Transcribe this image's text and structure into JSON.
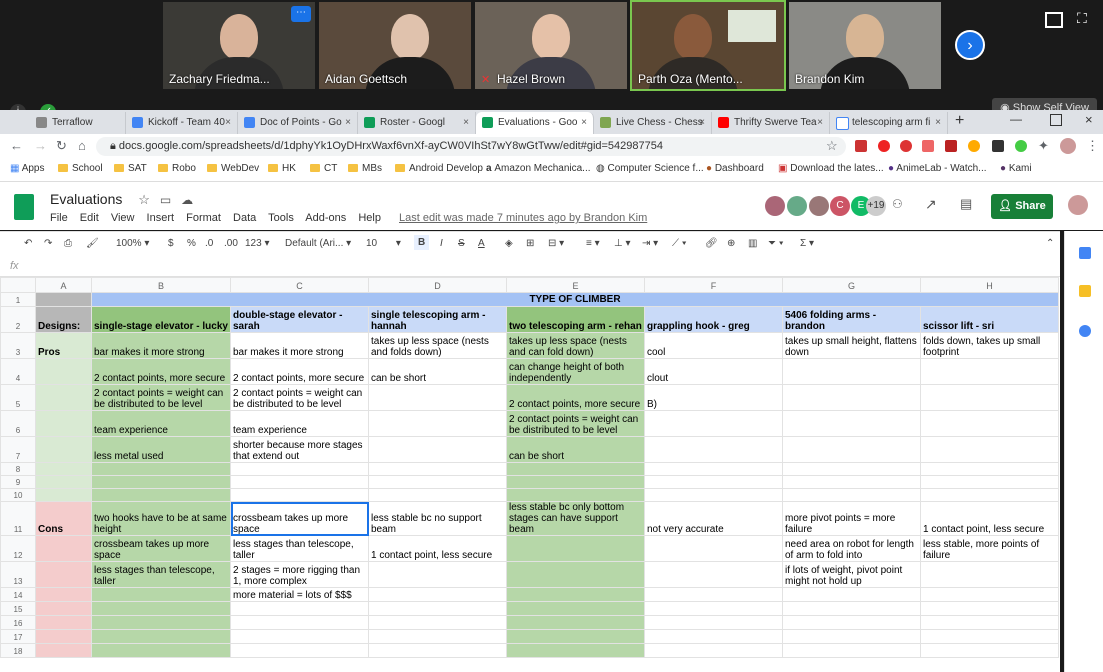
{
  "zoom": {
    "participants": [
      "Zachary Friedma...",
      "Aidan Goettsch",
      "Hazel Brown",
      "Parth Oza (Mento...",
      "Brandon Kim"
    ],
    "self_view_label": "Show Self View"
  },
  "browser": {
    "tabs": [
      {
        "title": "Terraflow"
      },
      {
        "title": "Kickoff - Team 40"
      },
      {
        "title": "Doc of Points - Go"
      },
      {
        "title": "Roster - Googl"
      },
      {
        "title": "Evaluations - Goo"
      },
      {
        "title": "Live Chess - Chess"
      },
      {
        "title": "Thrifty Swerve Tea"
      },
      {
        "title": "telescoping arm fi"
      }
    ],
    "url": "docs.google.com/spreadsheets/d/1dphyYk1OyDHrxWaxf6vnXf-ayCW0VIhSt7wY8wGtTww/edit#gid=542987754",
    "bookmarks": [
      "Apps",
      "School",
      "SAT",
      "Robo",
      "WebDev",
      "HK",
      "CT",
      "MBs",
      "Android Develop",
      "Amazon Mechanica...",
      "Computer Science f...",
      "Dashboard",
      "Download the lates...",
      "AnimeLab - Watch...",
      "Kami"
    ]
  },
  "sheet": {
    "title": "Evaluations",
    "menu": [
      "File",
      "Edit",
      "View",
      "Insert",
      "Format",
      "Data",
      "Tools",
      "Add-ons",
      "Help"
    ],
    "last_edit": "Last edit was made 7 minutes ago by Brandon Kim",
    "share_label": "Share",
    "avatar_letters": [
      "C",
      "E"
    ],
    "avatar_more": "+19",
    "toolbar": {
      "zoom": "100%",
      "currency": "$",
      "percent": "%",
      "dec_less": ".0",
      "dec_more": ".00",
      "format": "123",
      "font": "Default (Ari...",
      "size": "10",
      "bold": "B",
      "italic": "I",
      "strike": "S",
      "color": "A",
      "sigma": "Σ"
    },
    "fx": "fx",
    "columns": [
      "A",
      "B",
      "C",
      "D",
      "E",
      "F",
      "G",
      "H"
    ],
    "merged_header": "TYPE OF CLIMBER",
    "designs_label": "Designs:",
    "designs": [
      "single-stage elevator - lucky",
      "double-stage elevator - sarah",
      "single telescoping arm - hannah",
      "two telescoping arm - rehan",
      "grappling hook - greg",
      "5406 folding arms - brandon",
      "scissor lift - sri"
    ],
    "pros_label": "Pros",
    "cons_label": "Cons",
    "rows": [
      {
        "n": "3",
        "cells": [
          "",
          "bar makes it more strong",
          "bar makes it more strong",
          "takes up less space (nests and folds down)",
          "takes up less space (nests and can fold down)",
          "cool",
          "takes up small height, flattens down",
          "folds down, takes up small footprint"
        ]
      },
      {
        "n": "4",
        "cells": [
          "",
          "2 contact points, more secure",
          "2 contact points, more secure",
          "can be short",
          "can change height of both independently",
          "clout",
          "",
          ""
        ]
      },
      {
        "n": "5",
        "cells": [
          "",
          "2 contact points = weight can be distributed to be level",
          "2 contact points = weight can be distributed to be level",
          "",
          "2 contact points, more secure",
          "B)",
          "",
          ""
        ]
      },
      {
        "n": "6",
        "cells": [
          "",
          "team experience",
          "team experience",
          "",
          "2 contact points = weight can be distributed to be level",
          "",
          "",
          ""
        ]
      },
      {
        "n": "7",
        "cells": [
          "",
          "less metal used",
          "shorter because more stages that extend out",
          "",
          "can be short",
          "",
          "",
          ""
        ]
      },
      {
        "n": "8",
        "cells": [
          "",
          "",
          "",
          "",
          "",
          "",
          "",
          ""
        ]
      },
      {
        "n": "9",
        "cells": [
          "",
          "",
          "",
          "",
          "",
          "",
          "",
          ""
        ]
      },
      {
        "n": "10",
        "cells": [
          "",
          "",
          "",
          "",
          "",
          "",
          "",
          ""
        ]
      },
      {
        "n": "11",
        "cells": [
          "",
          "two hooks have to be at same height",
          "crossbeam takes up more space",
          "less stable bc no support beam",
          "less stable bc only bottom stages can have support beam",
          "not very accurate",
          "more pivot points = more failure",
          "1 contact point, less secure"
        ]
      },
      {
        "n": "12",
        "cells": [
          "",
          "crossbeam takes up more space",
          "less stages than telescope, taller",
          "1 contact point, less secure",
          "",
          "",
          "need area on robot for length of arm to fold into",
          "less stable, more points of failure"
        ]
      },
      {
        "n": "13",
        "cells": [
          "",
          "less stages than telescope, taller",
          "2 stages = more rigging than 1, more complex",
          "",
          "",
          "",
          "if lots of weight, pivot point might not hold up",
          ""
        ]
      },
      {
        "n": "14",
        "cells": [
          "",
          "",
          "more material = lots of $$$",
          "",
          "",
          "",
          "",
          ""
        ]
      },
      {
        "n": "15",
        "cells": [
          "",
          "",
          "",
          "",
          "",
          "",
          "",
          ""
        ]
      },
      {
        "n": "16",
        "cells": [
          "",
          "",
          "",
          "",
          "",
          "",
          "",
          ""
        ]
      },
      {
        "n": "17",
        "cells": [
          "",
          "",
          "",
          "",
          "",
          "",
          "",
          ""
        ]
      },
      {
        "n": "18",
        "cells": [
          "",
          "",
          "",
          "",
          "",
          "",
          "",
          ""
        ]
      }
    ]
  }
}
